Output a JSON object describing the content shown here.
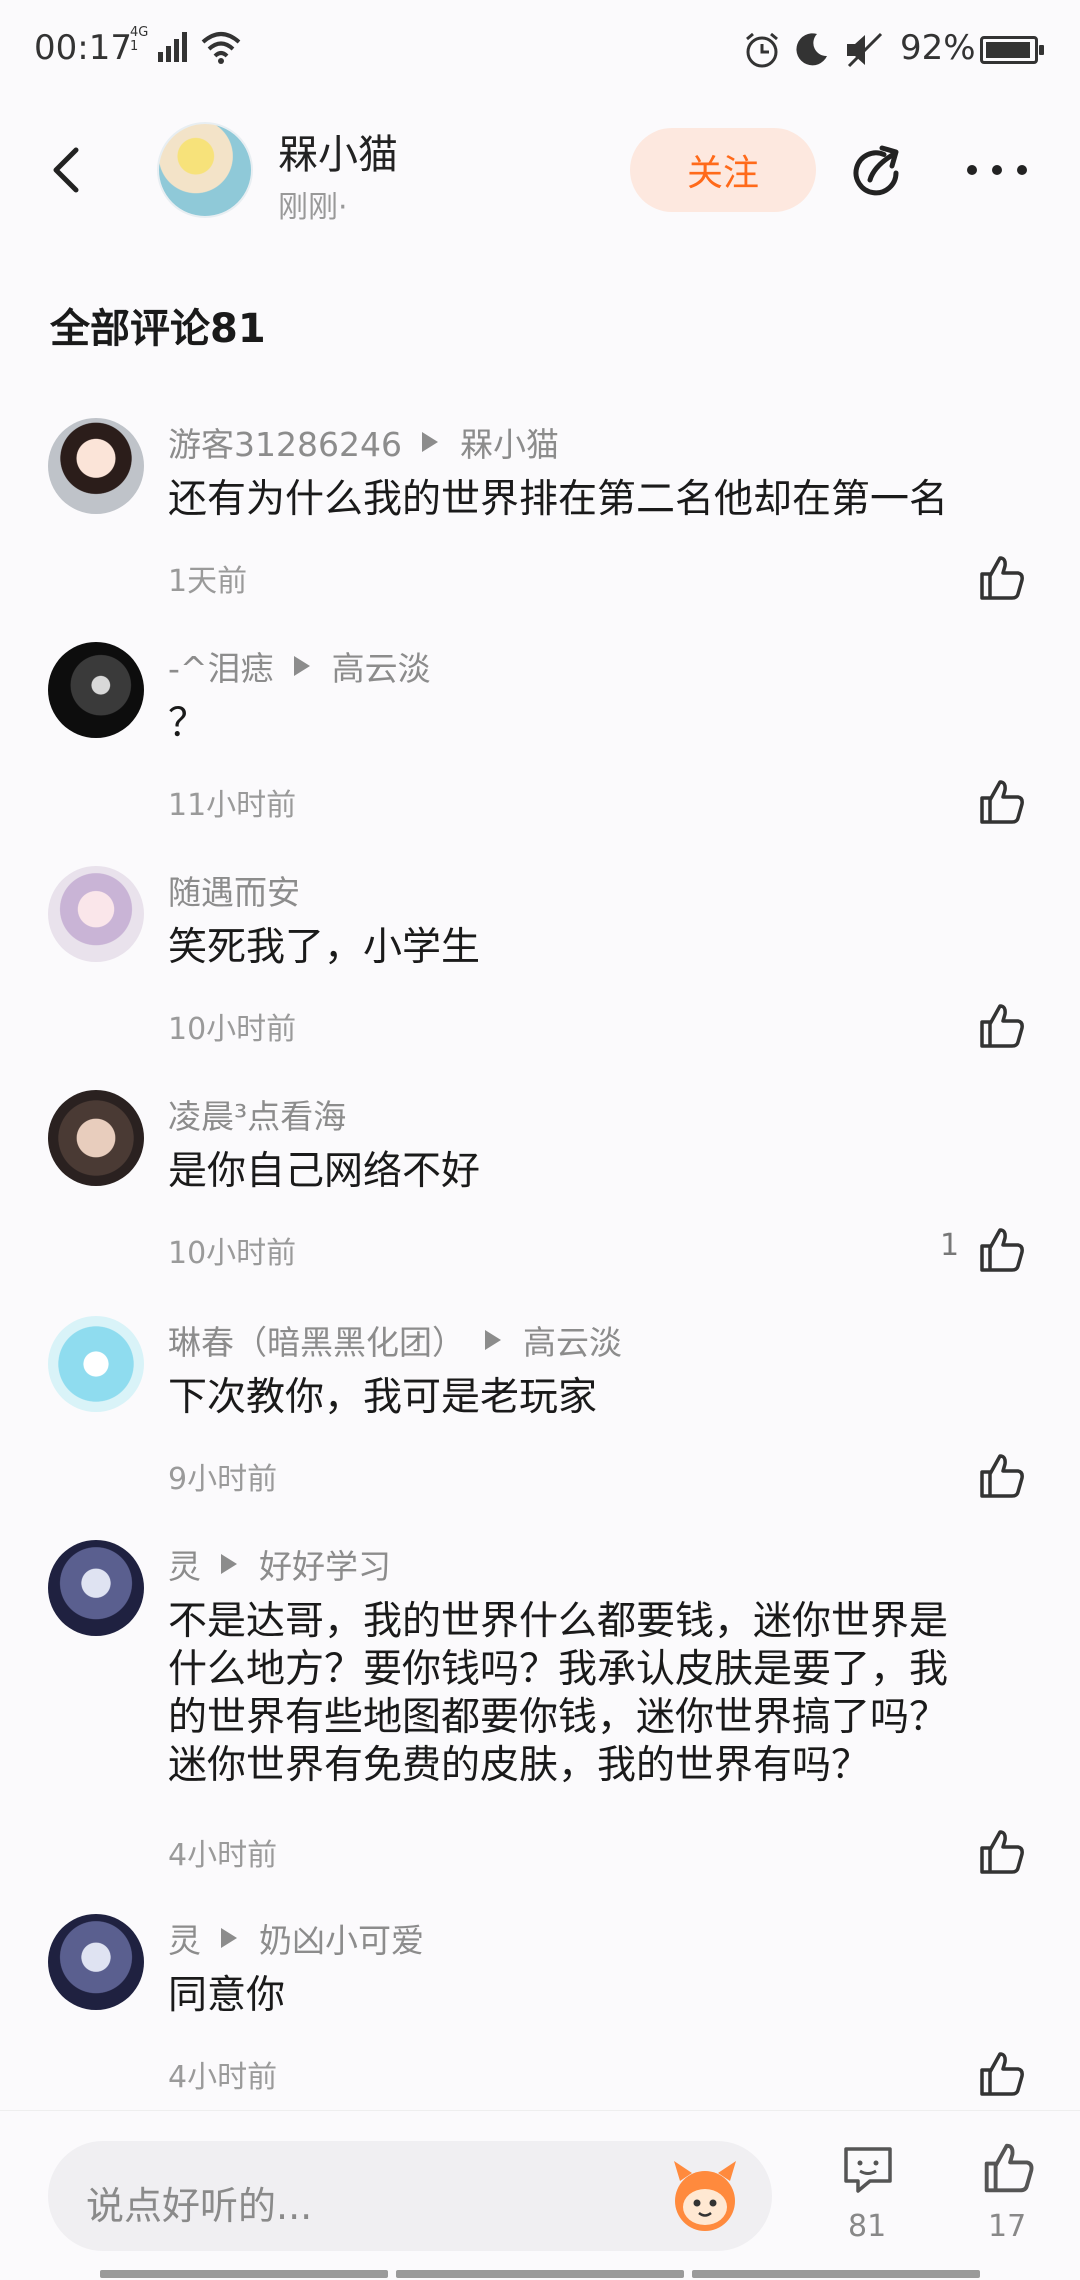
{
  "status_bar": {
    "time": "00:17",
    "network_top": "4G",
    "network_bottom": "1",
    "battery": "92%"
  },
  "header": {
    "author_name": "槑小猫",
    "post_time": "刚刚·",
    "follow_label": "关注"
  },
  "section_title": "全部评论81",
  "comments": [
    {
      "user": "游客31286246",
      "reply_to": "槑小猫",
      "text": "还有为什么我的世界排在第二名他却在第一名",
      "time": "1天前",
      "likes": ""
    },
    {
      "user": "-^泪痣",
      "reply_to": "高云淡",
      "text": "？",
      "time": "11小时前",
      "likes": ""
    },
    {
      "user": "随遇而安",
      "reply_to": "",
      "text": "笑死我了，小学生",
      "time": "10小时前",
      "likes": ""
    },
    {
      "user": "凌晨³点看海",
      "reply_to": "",
      "text": "是你自己网络不好",
      "time": "10小时前",
      "likes": "1"
    },
    {
      "user": "琳春（暗黑黑化团）",
      "reply_to": "高云淡",
      "text": "下次教你，我可是老玩家",
      "time": "9小时前",
      "likes": ""
    },
    {
      "user": "灵",
      "reply_to": "好好学习",
      "text_lines": [
        "不是达哥，我的世界什么都要钱，迷你世界是",
        "什么地方？要你钱吗？我承认皮肤是要了，我",
        "的世界有些地图都要你钱，迷你世界搞了吗？",
        "迷你世界有免费的皮肤，我的世界有吗？"
      ],
      "time": "4小时前",
      "likes": ""
    },
    {
      "user": "灵",
      "reply_to": "奶凶小可爱",
      "text": "同意你",
      "time": "4小时前",
      "likes": ""
    }
  ],
  "bottom_bar": {
    "placeholder": "说点好听的...",
    "comment_count": "81",
    "like_count": "17"
  },
  "colors": {
    "accent": "#ff6a1a",
    "follow_bg": "#fde8df",
    "muted_text": "#8c8c8c"
  },
  "icons": [
    "back-arrow-icon",
    "share-icon",
    "more-dots-icon",
    "thumbs-up-icon",
    "comment-bubble-icon",
    "mascot-icon"
  ]
}
